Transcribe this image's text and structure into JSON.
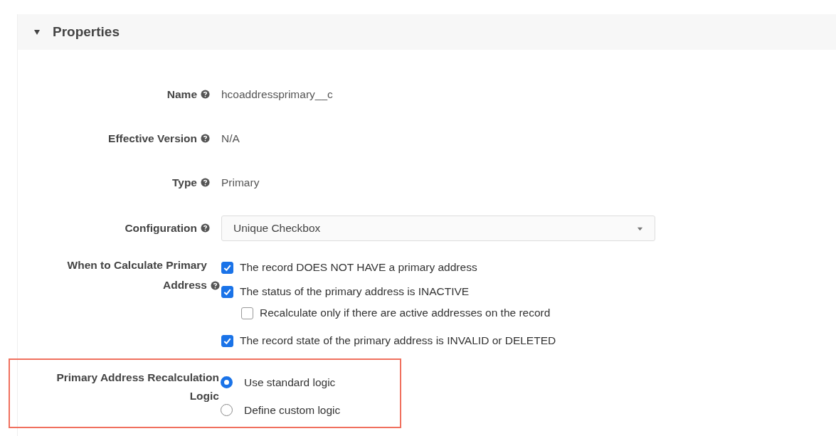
{
  "section": {
    "title": "Properties",
    "expanded": true
  },
  "fields": [
    {
      "kind": "text",
      "label": "Name",
      "value": "hcoaddressprimary__c"
    },
    {
      "kind": "text",
      "label": "Effective Version",
      "value": "N/A"
    },
    {
      "kind": "text",
      "label": "Type",
      "value": "Primary"
    },
    {
      "kind": "select",
      "label": "Configuration",
      "value": "Unique Checkbox"
    },
    {
      "kind": "checkboxes",
      "label": "When to Calculate Primary Address",
      "options": [
        {
          "label": "The record DOES NOT HAVE a primary address",
          "checked": true
        },
        {
          "label": "The status of the primary address is INACTIVE",
          "checked": true,
          "children": [
            {
              "label": "Recalculate only if there are active addresses on the record",
              "checked": false
            }
          ]
        },
        {
          "label": "The record state of the primary address is INVALID or DELETED",
          "checked": true
        }
      ]
    },
    {
      "kind": "radios",
      "label": "Primary Address Recalculation Logic",
      "highlighted": true,
      "options": [
        {
          "label": "Use standard logic",
          "selected": true
        },
        {
          "label": "Define custom logic",
          "selected": false
        }
      ]
    }
  ]
}
